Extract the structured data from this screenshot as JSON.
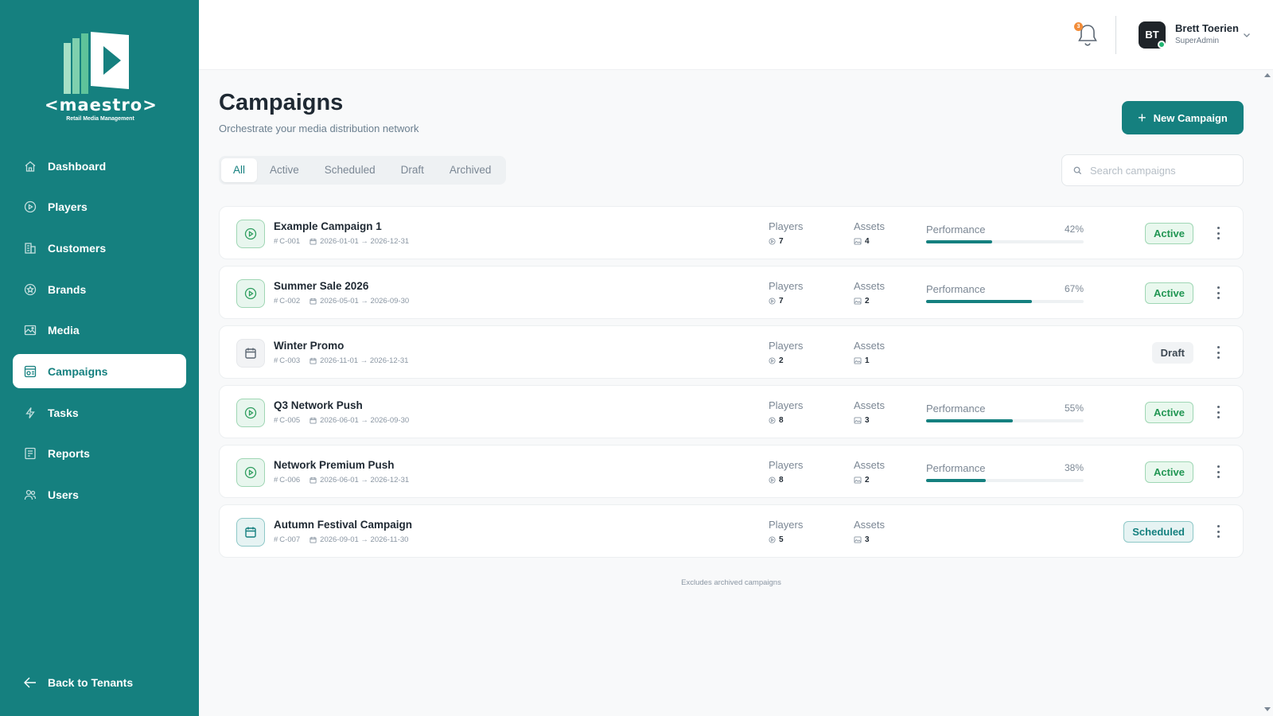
{
  "brand": {
    "name": "<maestro>",
    "tagline": "Retail Media Management",
    "accent": "#15807f"
  },
  "sidebar": {
    "items": [
      {
        "label": "Dashboard",
        "icon": "home-icon"
      },
      {
        "label": "Players",
        "icon": "play-circle-icon"
      },
      {
        "label": "Customers",
        "icon": "building-icon"
      },
      {
        "label": "Brands",
        "icon": "star-badge-icon"
      },
      {
        "label": "Media",
        "icon": "image-icon"
      },
      {
        "label": "Campaigns",
        "icon": "campaign-icon",
        "active": true
      },
      {
        "label": "Tasks",
        "icon": "lightning-icon"
      },
      {
        "label": "Reports",
        "icon": "report-icon"
      },
      {
        "label": "Users",
        "icon": "users-icon"
      }
    ],
    "back_label": "Back to Tenants"
  },
  "topbar": {
    "notification_count": "3",
    "user": {
      "initials": "BT",
      "name": "Brett Toerien",
      "role": "SuperAdmin"
    }
  },
  "page": {
    "title": "Campaigns",
    "subtitle": "Orchestrate your media distribution network",
    "new_button_label": "New Campaign",
    "tabs": [
      "All",
      "Active",
      "Scheduled",
      "Draft",
      "Archived"
    ],
    "active_tab": "All",
    "search_placeholder": "Search campaigns",
    "footnote": "Excludes archived campaigns",
    "col_players": "Players",
    "col_assets": "Assets",
    "col_performance": "Performance"
  },
  "campaigns": [
    {
      "name": "Example Campaign 1",
      "code": "C-001",
      "dates": "2026-01-01 → 2026-12-31",
      "players": "7",
      "assets": "4",
      "performance": 42,
      "performance_label": "42%",
      "status": "Active",
      "icon": "play-circle-icon"
    },
    {
      "name": "Summer Sale 2026",
      "code": "C-002",
      "dates": "2026-05-01 → 2026-09-30",
      "players": "7",
      "assets": "2",
      "performance": 67,
      "performance_label": "67%",
      "status": "Active",
      "icon": "play-circle-icon"
    },
    {
      "name": "Winter Promo",
      "code": "C-003",
      "dates": "2026-11-01 → 2026-12-31",
      "players": "2",
      "assets": "1",
      "performance": null,
      "performance_label": null,
      "status": "Draft",
      "icon": "calendar-icon"
    },
    {
      "name": "Q3 Network Push",
      "code": "C-005",
      "dates": "2026-06-01 → 2026-09-30",
      "players": "8",
      "assets": "3",
      "performance": 55,
      "performance_label": "55%",
      "status": "Active",
      "icon": "play-circle-icon"
    },
    {
      "name": "Network Premium Push",
      "code": "C-006",
      "dates": "2026-06-01 → 2026-12-31",
      "players": "8",
      "assets": "2",
      "performance": 38,
      "performance_label": "38%",
      "status": "Active",
      "icon": "play-circle-icon"
    },
    {
      "name": "Autumn Festival Campaign",
      "code": "C-007",
      "dates": "2026-09-01 → 2026-11-30",
      "players": "5",
      "assets": "3",
      "performance": null,
      "performance_label": null,
      "status": "Scheduled",
      "icon": "calendar-icon"
    }
  ]
}
